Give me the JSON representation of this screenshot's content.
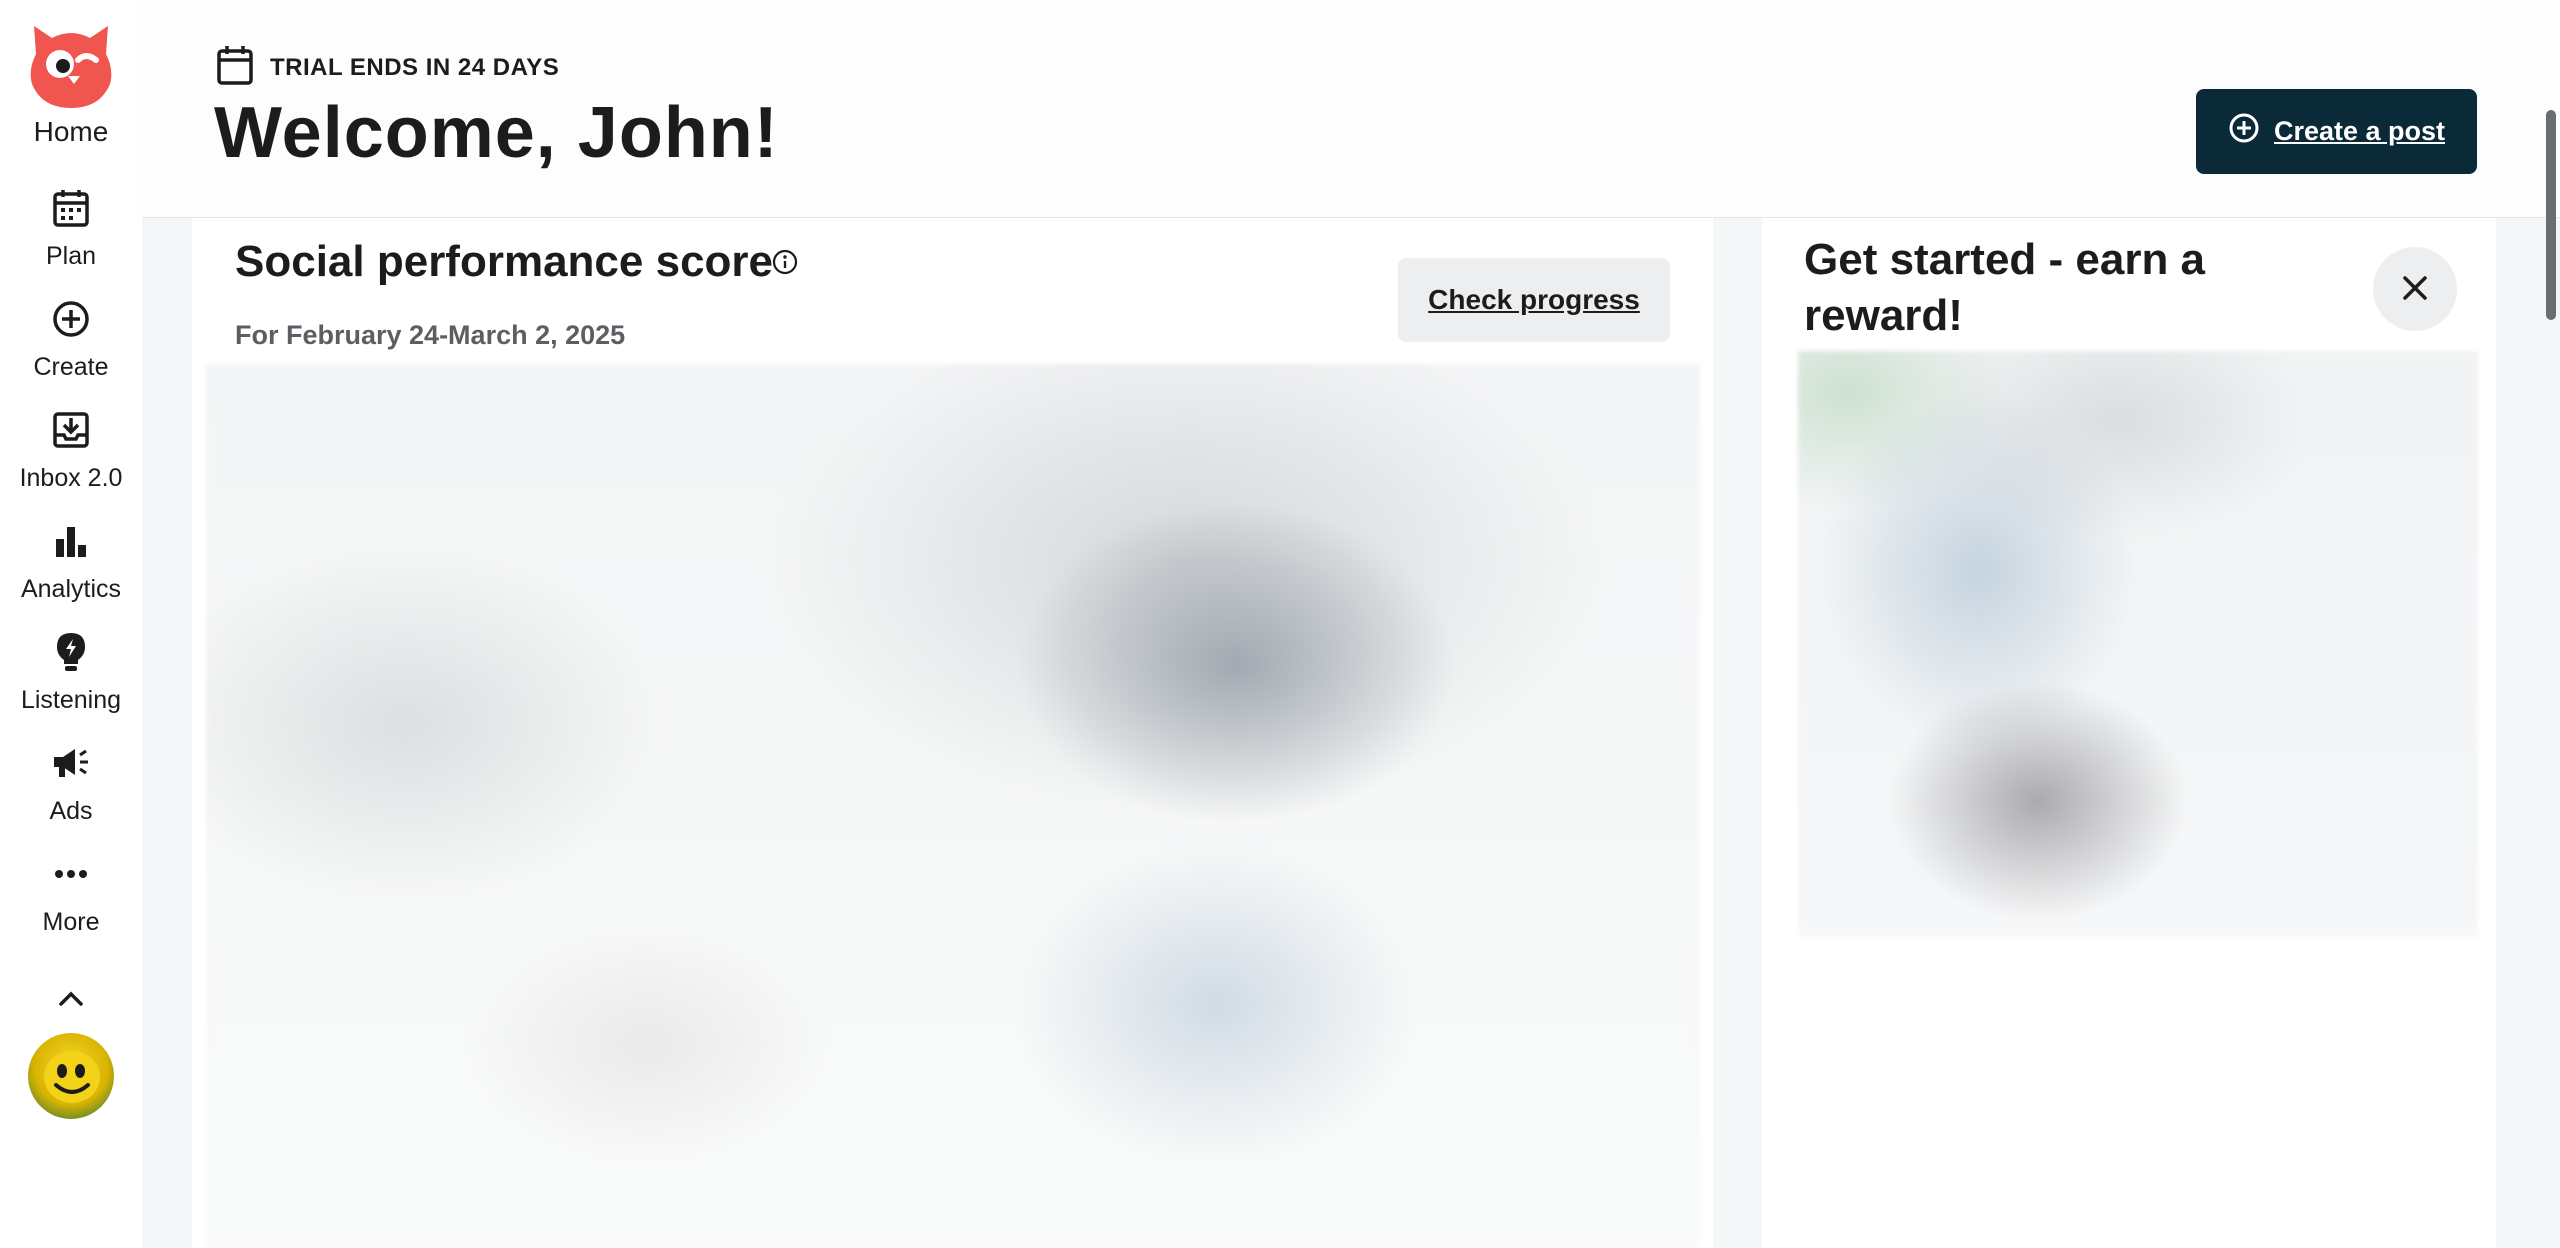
{
  "sidebar": {
    "items": [
      {
        "label": "Home",
        "icon": "owl-logo"
      },
      {
        "label": "Plan",
        "icon": "calendar-icon"
      },
      {
        "label": "Create",
        "icon": "plus-circle-icon"
      },
      {
        "label": "Inbox 2.0",
        "icon": "inbox-icon"
      },
      {
        "label": "Analytics",
        "icon": "bar-chart-icon"
      },
      {
        "label": "Listening",
        "icon": "lightbulb-icon"
      },
      {
        "label": "Ads",
        "icon": "megaphone-icon"
      },
      {
        "label": "More",
        "icon": "more-dots-icon"
      }
    ]
  },
  "header": {
    "trial_text": "TRIAL ENDS IN 24 DAYS",
    "welcome": "Welcome, John!",
    "create_post_label": "Create a post"
  },
  "score_card": {
    "title": "Social performance score",
    "date_range": "For February 24-March 2, 2025",
    "check_progress_label": "Check progress"
  },
  "reward_card": {
    "title": "Get started - earn a reward!"
  },
  "colors": {
    "brand_red": "#f0554f",
    "primary_button": "#0b2a37",
    "secondary_button": "#eceef0",
    "page_background": "#f5f6f7"
  }
}
